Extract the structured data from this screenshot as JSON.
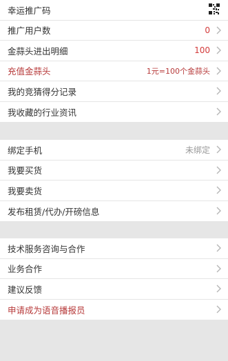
{
  "section1": [
    {
      "label": "幸运推广码",
      "value": "",
      "icon": "qr-code-icon",
      "chevron": false
    },
    {
      "label": "推广用户数",
      "value": "0",
      "value_color": "#d33a3a",
      "chevron": true
    },
    {
      "label": "金蒜头进出明细",
      "value": "100",
      "value_color": "#d33a3a",
      "chevron": true
    },
    {
      "label": "充值金蒜头",
      "label_color": "#b73a3a",
      "value": "1元=100个金蒜头",
      "value_color": "#b73a3a",
      "chevron": true
    },
    {
      "label": "我的竞猜得分记录",
      "value": "",
      "chevron": true
    },
    {
      "label": "我收藏的行业资讯",
      "value": "",
      "chevron": true
    }
  ],
  "section2": [
    {
      "label": "绑定手机",
      "value": "未绑定",
      "value_color": "#999999",
      "chevron": true
    },
    {
      "label": "我要买货",
      "value": "",
      "chevron": true
    },
    {
      "label": "我要卖货",
      "value": "",
      "chevron": true
    },
    {
      "label": "发布租赁/代办/开磅信息",
      "value": "",
      "chevron": true
    }
  ],
  "section3": [
    {
      "label": "技术服务咨询与合作",
      "value": "",
      "chevron": true
    },
    {
      "label": "业务合作",
      "value": "",
      "chevron": true
    },
    {
      "label": "建议反馈",
      "value": "",
      "chevron": true
    },
    {
      "label": "申请成为语音播报员",
      "label_color": "#b73a3a",
      "value": "",
      "chevron": true
    }
  ]
}
